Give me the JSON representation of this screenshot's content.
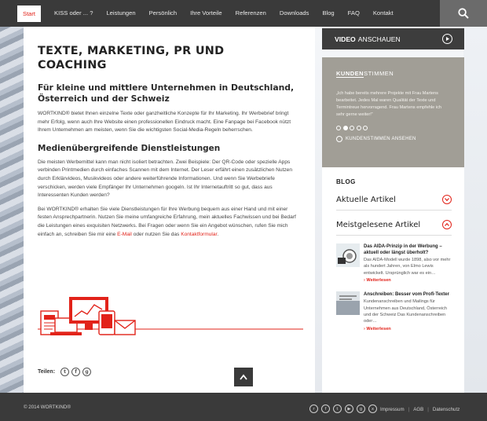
{
  "nav": {
    "items": [
      "Start",
      "KISS oder ... ?",
      "Leistungen",
      "Persönlich",
      "Ihre Vorteile",
      "Referenzen",
      "Downloads",
      "Blog",
      "FAQ",
      "Kontakt"
    ]
  },
  "main": {
    "title": "TEXTE, MARKETING, PR UND COACHING",
    "subtitle": "Für kleine und mittlere Unternehmen in Deutschland, Österreich und der Schweiz",
    "p1": "WORTKIND® bietet Ihnen einzelne Texte oder ganzheitliche Konzepte für Ihr Marketing. Ihr Werbebrief bringt mehr Erfolg, wenn auch Ihre Website einen professionellen Eindruck macht. Eine Fanpage bei Facebook nützt Ihrem Unternehmen am meisten, wenn Sie die wichtigsten Social-Media-Regeln beherrschen.",
    "heading2": "Medienübergreifende Dienstleistungen",
    "p2": "Die meisten Werbemittel kann man nicht isoliert betrachten. Zwei Beispiele: Der QR-Code oder spezielle Apps verbinden Printmedien durch einfaches Scannen mit dem Internet. Der Leser erfährt einen zusätzlichen Nutzen durch Erklärvideos, Musikvideos oder andere weiterführende Informationen. Und wenn Sie Werbebriefe verschicken, werden viele Empfänger Ihr Unternehmen googeln. Ist Ihr Internetauftritt so gut, dass aus Interessenten Kunden werden?",
    "p3_part1": "Bei WORTKIND® erhalten Sie viele Dienstleistungen für Ihre Werbung bequem aus einer Hand und mit einer festen Ansprechpartnerin. Nutzen Sie meine umfangreiche Erfahrung, mein aktuelles Fachwissen und bei Bedarf die Leistungen eines exquisiten Netzwerks. Bei Fragen oder wenn Sie ein Angebot wünschen, rufen Sie mich einfach an, schreiben Sie mir eine ",
    "p3_link1": "E-Mail",
    "p3_part2": " oder nutzen Sie das ",
    "p3_link2": "Kontaktformular",
    "p3_end": ".",
    "share_label": "Teilen:"
  },
  "sidebar": {
    "video_bold": "VIDEO",
    "video_rest": "ANSCHAUEN",
    "kunden_bold": "KUNDEN",
    "kunden_rest": "STIMMEN",
    "quote": "„Ich habe bereits mehrere Projekte mit Frau Martens bearbeitet. Jedes Mal waren Qualität der Texte und Termintreue hervorragend. Frau Martens empfehle ich sehr gerne weiter!“",
    "kunden_link": "KUNDENSTIMMEN ANSEHEN",
    "blog_title": "BLOG",
    "acc1": "Aktuelle Artikel",
    "acc2": "Meistgelesene Artikel",
    "posts": [
      {
        "title": "Das AIDA-Prinzip in der Werbung – aktuell oder längst überholt?",
        "text": "Das AIDA-Modell wurde 1898, also vor mehr als hundert Jahren, von Elmo Lewis entwickelt. Ursprünglich war es ein…",
        "more": "Weiterlesen"
      },
      {
        "title": "Anschreiben: Besser vom Profi-Texter",
        "text": "Kundenanschreiben und Mailings für Unternehmen aus Deutschland, Österreich und der Schweiz Das Kundenanschreiben oder…",
        "more": "Weiterlesen"
      }
    ]
  },
  "footer": {
    "copyright": "© 2014 WORTKIND®",
    "links": [
      "Impressum",
      "AGB",
      "Datenschutz"
    ]
  },
  "colors": {
    "accent": "#e2231a",
    "nav_bg": "#3a3a3a",
    "kunden_bg": "#a19e96"
  },
  "icons": [
    "search-icon",
    "play-icon",
    "twitter-icon",
    "facebook-icon",
    "google-plus-icon",
    "rss-icon",
    "youtube-icon",
    "xing-icon",
    "chevron-up-icon"
  ]
}
